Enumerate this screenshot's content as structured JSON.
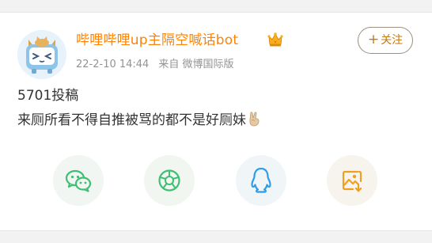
{
  "post": {
    "author": "哔哩哔哩up主隔空喊话bot",
    "time": "22-2-10 14:44",
    "source": "来自 微博国际版",
    "follow_label": "关注",
    "follow_plus": "+",
    "line1": "5701投稿",
    "line2": "来厕所看不得自推被骂的都不是好厕妹"
  },
  "share": [
    {
      "icon": "wechat-icon",
      "color": "#3fbf73"
    },
    {
      "icon": "moments-icon",
      "color": "#3fbf73"
    },
    {
      "icon": "qq-icon",
      "color": "#2e9ce6"
    },
    {
      "icon": "save-image-icon",
      "color": "#f0a020"
    }
  ],
  "colors": {
    "username": "#ff8200",
    "follow": "#c47a12",
    "meta": "#939393",
    "text": "#333333"
  }
}
